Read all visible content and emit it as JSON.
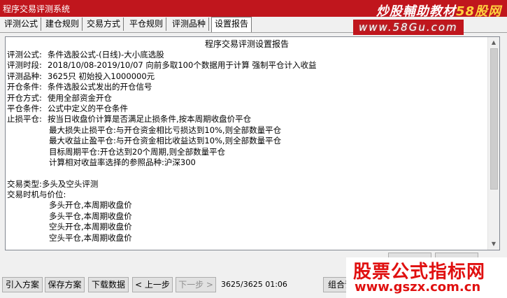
{
  "window": {
    "title": "程序交易评测系统",
    "brand_main": "炒股輔助教材",
    "brand_accent": "58股网",
    "url_watermark": "www.58Gu.com"
  },
  "tabs": [
    "评测公式",
    "建仓规则",
    "交易方式",
    "平仓规则",
    "评测品种",
    "设置报告"
  ],
  "report": {
    "title": "程序交易评测设置报告",
    "rows": [
      {
        "label": "评测公式:",
        "text": "条件选股公式-(日线)-大小底选股"
      },
      {
        "label": "评测时段:",
        "text": "2018/10/08-2019/10/07 向前多取100个数据用于计算 强制平仓计入收益"
      },
      {
        "label": "评测品种:",
        "text": "3625只 初始投入1000000元"
      },
      {
        "label": "开仓条件:",
        "text": "条件选股公式发出的开仓信号"
      },
      {
        "label": "开仓方式:",
        "text": "使用全部资金开仓"
      },
      {
        "label": "平仓条件:",
        "text": "公式中定义的平仓条件"
      },
      {
        "label": "止损平仓:",
        "text": "按当日收盘价计算是否满足止损条件,按本周期收盘价平仓"
      }
    ],
    "stop_rules": [
      "最大损失止损平仓:与开仓资金相比亏损达到10%,则全部数量平仓",
      "最大收益止盈平仓:与开仓资金相比收益达到10%,则全部数量平仓",
      "目标周期平仓:开仓达到20个周期,则全部数量平仓",
      "计算相对收益率选择的参照品种:沪深300"
    ],
    "trade_type": "交易类型:多头及空头评测",
    "timing_label": "交易时机与价位:",
    "timing_items": [
      "多头开仓,本周期收盘价",
      "多头平仓,本周期收盘价",
      "空头开仓,本周期收盘价",
      "空头平仓,本周期收盘价"
    ]
  },
  "buttons": {
    "import": "引入方案",
    "save": "保存方案",
    "download": "下载数据",
    "prev": "< 上一步",
    "next": "下一步 >",
    "combo": "组合评"
  },
  "status": {
    "progress": "3625/3625 01:06"
  },
  "promo": {
    "big": "股票公式指标网",
    "small": "www.gszx.com.cn"
  },
  "colors": {
    "titlebar": "#c0161d",
    "promo_red": "#e01010"
  }
}
